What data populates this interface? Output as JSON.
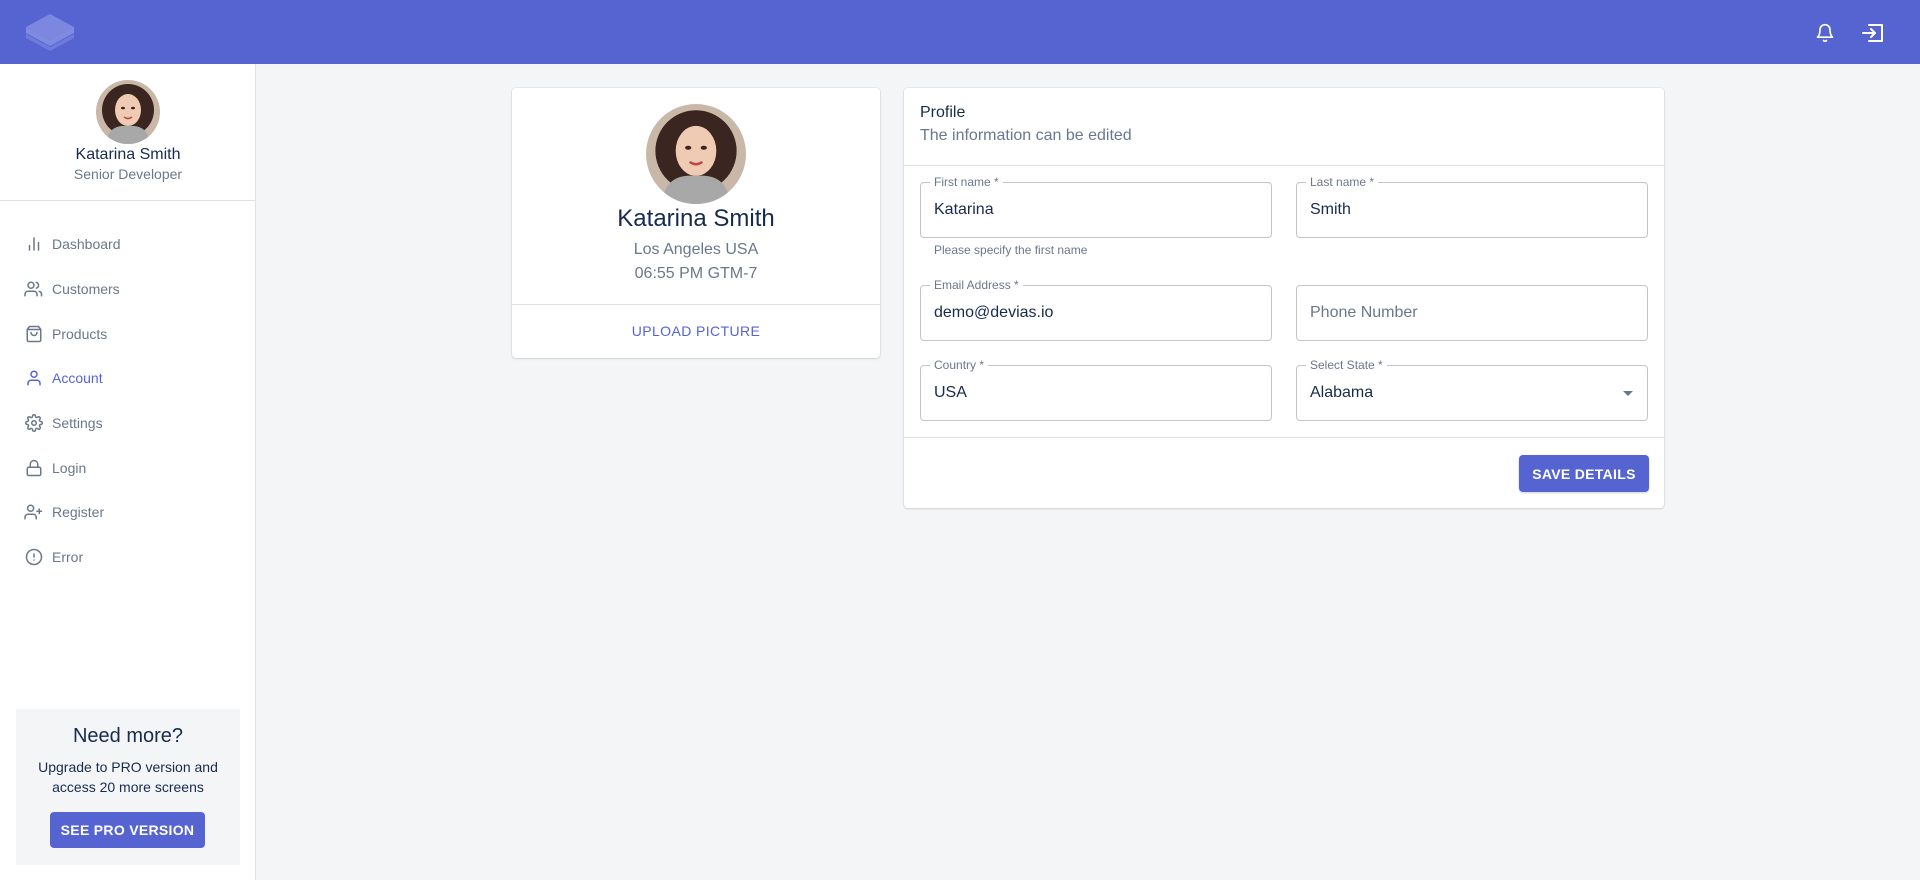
{
  "brand": {
    "accent": "#5664d2",
    "logo_icon": "layers-logo-icon"
  },
  "topbar": {
    "notifications_icon": "bell-icon",
    "logout_icon": "logout-icon"
  },
  "sidebar": {
    "user": {
      "name": "Katarina Smith",
      "role": "Senior Developer",
      "avatar_icon": "user-avatar"
    },
    "items": [
      {
        "label": "Dashboard",
        "icon": "bar-chart-icon",
        "active": false
      },
      {
        "label": "Customers",
        "icon": "users-icon",
        "active": false
      },
      {
        "label": "Products",
        "icon": "shopping-bag-icon",
        "active": false
      },
      {
        "label": "Account",
        "icon": "user-icon",
        "active": true
      },
      {
        "label": "Settings",
        "icon": "gear-icon",
        "active": false
      },
      {
        "label": "Login",
        "icon": "lock-icon",
        "active": false
      },
      {
        "label": "Register",
        "icon": "user-plus-icon",
        "active": false
      },
      {
        "label": "Error",
        "icon": "alert-circle-icon",
        "active": false
      }
    ],
    "promo": {
      "title": "Need more?",
      "text": "Upgrade to PRO version and access 20 more screens",
      "button": "SEE PRO VERSION"
    }
  },
  "profile_card": {
    "name": "Katarina Smith",
    "location": "Los Angeles USA",
    "time": "06:55 PM GTM-7",
    "upload_button": "UPLOAD PICTURE"
  },
  "form": {
    "title": "Profile",
    "subtitle": "The information can be edited",
    "fields": {
      "first_name": {
        "label": "First name *",
        "value": "Katarina",
        "helper": "Please specify the first name"
      },
      "last_name": {
        "label": "Last name *",
        "value": "Smith"
      },
      "email": {
        "label": "Email Address *",
        "value": "demo@devias.io"
      },
      "phone": {
        "placeholder": "Phone Number",
        "value": ""
      },
      "country": {
        "label": "Country *",
        "value": "USA"
      },
      "state": {
        "label": "Select State *",
        "value": "Alabama"
      }
    },
    "save_button": "SAVE DETAILS"
  }
}
